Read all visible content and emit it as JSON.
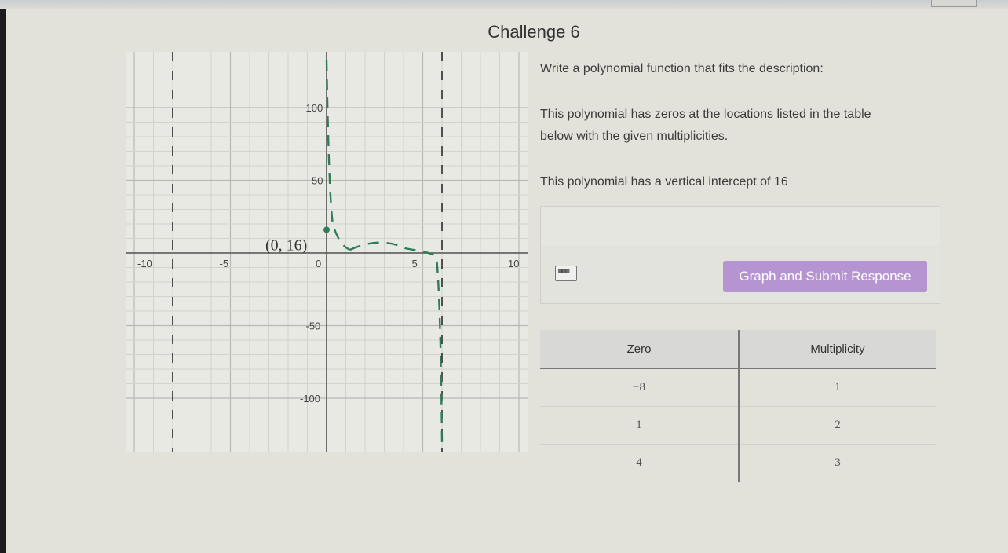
{
  "challenge_title": "Challenge 6",
  "graph": {
    "x_ticks": [
      "-10",
      "-5",
      "0",
      "5",
      "10"
    ],
    "y_ticks": [
      "100",
      "50",
      "-50",
      "-100"
    ],
    "point_label": "(0, 16)",
    "highlight_point": {
      "x": 0,
      "y": 16
    },
    "x_range": [
      -10,
      10
    ],
    "y_range": [
      -100,
      100
    ],
    "asymptote_x": [
      -8,
      6
    ],
    "curve_color": "#2e7d57"
  },
  "prompt": {
    "instruction": "Write a polynomial function that fits the description:",
    "zeros_description_line1": "This polynomial has zeros at the locations listed in the table",
    "zeros_description_line2": "below with the given multiplicities.",
    "intercept_description": "This polynomial has a vertical intercept of 16"
  },
  "answer": {
    "value": ""
  },
  "toolbar": {
    "keyboard_icon": "keyboard-icon",
    "submit_label": "Graph and Submit Response",
    "submit_color": "#b694d2"
  },
  "table": {
    "headers": [
      "Zero",
      "Multiplicity"
    ],
    "rows": [
      {
        "zero": "−8",
        "multiplicity": "1"
      },
      {
        "zero": "1",
        "multiplicity": "2"
      },
      {
        "zero": "4",
        "multiplicity": "3"
      }
    ]
  }
}
